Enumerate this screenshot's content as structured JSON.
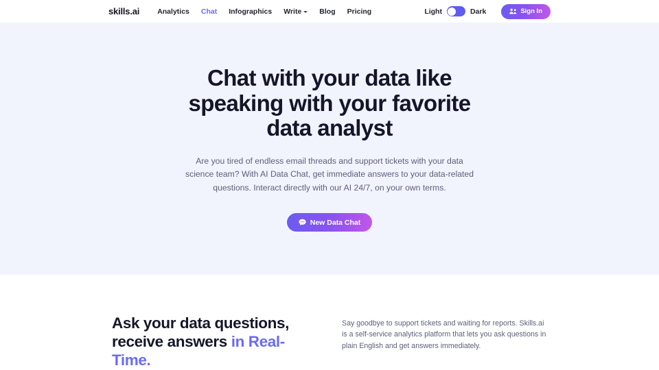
{
  "header": {
    "logo": "skills.ai",
    "nav_items": [
      {
        "label": "Analytics",
        "active": false,
        "has_caret": false
      },
      {
        "label": "Chat",
        "active": true,
        "has_caret": false
      },
      {
        "label": "Infographics",
        "active": false,
        "has_caret": false
      },
      {
        "label": "Write",
        "active": false,
        "has_caret": true
      },
      {
        "label": "Blog",
        "active": false,
        "has_caret": false
      },
      {
        "label": "Pricing",
        "active": false,
        "has_caret": false
      }
    ],
    "theme_toggle": {
      "light_label": "Light",
      "dark_label": "Dark",
      "state": "light"
    },
    "signin_label": "Sign In",
    "signin_icon": "users-icon"
  },
  "hero": {
    "title": "Chat with your data like speaking with your favorite data analyst",
    "subtitle": "Are you tired of endless email threads and support tickets with your data science team? With AI Data Chat, get immediate answers to your data-related questions. Interact directly with our AI 24/7, on your own terms.",
    "cta_label": "New Data Chat",
    "cta_icon": "chat-bubble-icon"
  },
  "section_two": {
    "title_part1": "Ask your data questions, receive answers ",
    "title_accent": "in Real-Time.",
    "body": "Say goodbye to support tickets and waiting for reports. Skills.ai is a self-service analytics platform that lets you ask questions in plain English and get answers immediately."
  },
  "colors": {
    "accent": "#6b6bf5",
    "gradient_start": "#6a5cf0",
    "gradient_end": "#c457e8",
    "hero_bg": "#f1f4fd",
    "heading": "#14162a",
    "body_text": "#5b5f78"
  }
}
